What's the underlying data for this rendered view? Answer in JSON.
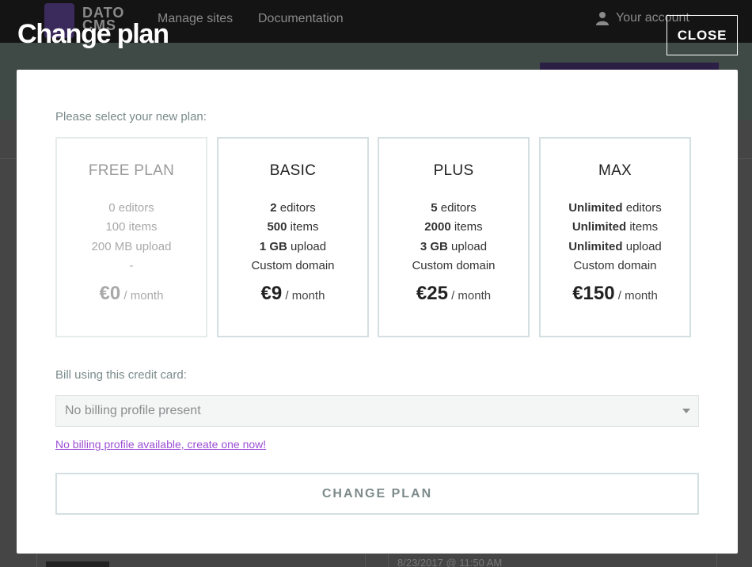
{
  "background": {
    "logo_text_line1": "DATO",
    "logo_text_line2": "CMS",
    "nav": [
      "Manage sites",
      "Documentation"
    ],
    "account_label": "Your account",
    "date_text": "8/23/2017 @ 11:50 AM"
  },
  "modal": {
    "title": "Change plan",
    "close_label": "CLOSE",
    "select_plan_label": "Please select your new plan:",
    "plans": [
      {
        "name": "FREE PLAN",
        "editors_value": "0",
        "editors_text": " editors",
        "items_value": "100",
        "items_text": " items",
        "upload_value": "200 MB",
        "upload_text": " upload",
        "domain": "-",
        "price": "€0",
        "per": " / month"
      },
      {
        "name": "BASIC",
        "editors_value": "2",
        "editors_text": " editors",
        "items_value": "500",
        "items_text": " items",
        "upload_value": "1 GB",
        "upload_text": " upload",
        "domain": "Custom domain",
        "price": "€9",
        "per": " / month"
      },
      {
        "name": "PLUS",
        "editors_value": "5",
        "editors_text": " editors",
        "items_value": "2000",
        "items_text": " items",
        "upload_value": "3 GB",
        "upload_text": " upload",
        "domain": "Custom domain",
        "price": "€25",
        "per": " / month"
      },
      {
        "name": "MAX",
        "editors_value": "Unlimited",
        "editors_text": " editors",
        "items_value": "Unlimited",
        "items_text": " items",
        "upload_value": "Unlimited",
        "upload_text": " upload",
        "domain": "Custom domain",
        "price": "€150",
        "per": " / month"
      }
    ],
    "bill_label": "Bill using this credit card:",
    "billing_select_value": "No billing profile present",
    "create_link": "No billing profile available, create one now!",
    "submit_label": "CHANGE PLAN"
  }
}
